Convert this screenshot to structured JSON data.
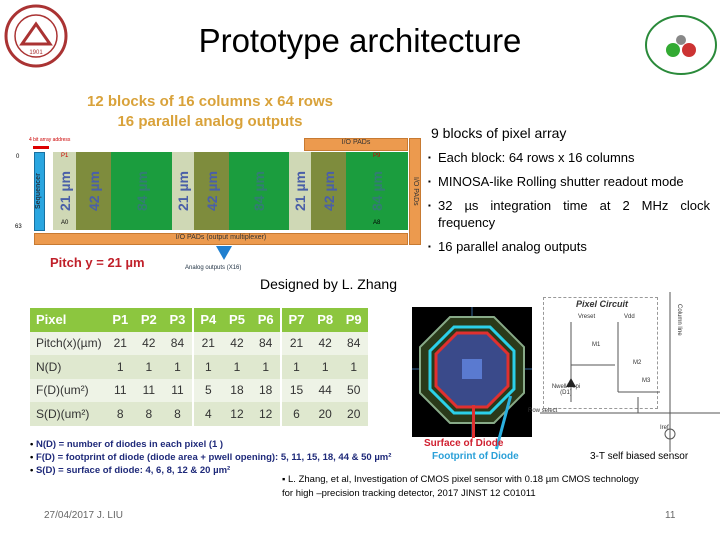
{
  "title": "Prototype architecture",
  "diagram": {
    "heading1": "12 blocks of 16 columns x 64 rows",
    "heading2": "16 parallel analog outputs",
    "address_label": "4 bit array address",
    "sequencer": "Sequencer",
    "io_top": "I/O PADs",
    "io_right": "I/O PADs",
    "io_bottom": "I/O PADs (output multiplexer)",
    "analog_outputs": "Analog outputs (X16)",
    "pitch_y": "Pitch y = 21 µm",
    "row_top": "0",
    "row_bottom": "63",
    "p1": "P1",
    "p9": "P9",
    "a0": "A0",
    "a8": "A8",
    "blocks": [
      "21 µm",
      "42 µm",
      "84 µm",
      "21 µm",
      "42 µm",
      "84 µm",
      "21 µm",
      "42 µm",
      "84 µm"
    ]
  },
  "designed_by": "Designed by L. Zhang",
  "right_heading": "9 blocks of pixel array",
  "right_bullets": [
    "Each block: 64 rows x 16 columns",
    "MINOSA-like Rolling shutter readout mode",
    "32 µs integration time at 2 MHz clock frequency",
    "16 parallel analog outputs"
  ],
  "table": {
    "header": [
      "Pixel",
      "P1",
      "P2",
      "P3",
      "P4",
      "P5",
      "P6",
      "P7",
      "P8",
      "P9"
    ],
    "rows": [
      [
        "Pitch(x)(µm)",
        "21",
        "42",
        "84",
        "21",
        "42",
        "84",
        "21",
        "42",
        "84"
      ],
      [
        "N(D)",
        "1",
        "1",
        "1",
        "1",
        "1",
        "1",
        "1",
        "1",
        "1"
      ],
      [
        "F(D)(um²)",
        "11",
        "11",
        "11",
        "5",
        "18",
        "18",
        "15",
        "44",
        "50"
      ],
      [
        "S(D)(um²)",
        "8",
        "8",
        "8",
        "4",
        "12",
        "12",
        "6",
        "20",
        "20"
      ]
    ]
  },
  "notes": [
    "N(D) = number of diodes in each pixel (1 )",
    "F(D) = footprint of diode (diode area + pwell opening): 5, 11, 15, 18, 44 & 50 µm²",
    "S(D) = surface of diode: 4, 6, 8, 12 & 20 µm²"
  ],
  "layout_image": {
    "surface": "Surface of Diode",
    "footprint": "Footprint of Diode"
  },
  "circuit": {
    "title": "Pixel Circuit",
    "vreset": "Vreset",
    "vdd": "Vdd",
    "m1": "M1",
    "m2": "M2",
    "m3": "M3",
    "diode": "Nwell/Pepi (D1)",
    "row_select": "Row select",
    "column_line": "Column line",
    "iref": "Iref",
    "caption": "3-T self biased sensor"
  },
  "reference": "▪ L. Zhang, et al,  Investigation of CMOS pixel sensor with 0.18 µm CMOS technology for high –precision tracking detector, 2017 JINST 12 C01011",
  "footer": {
    "date": "27/04/2017 J. LIU",
    "page": "11"
  },
  "logos": {
    "left": "SHANDONG UNIVERSITY 1901"
  }
}
